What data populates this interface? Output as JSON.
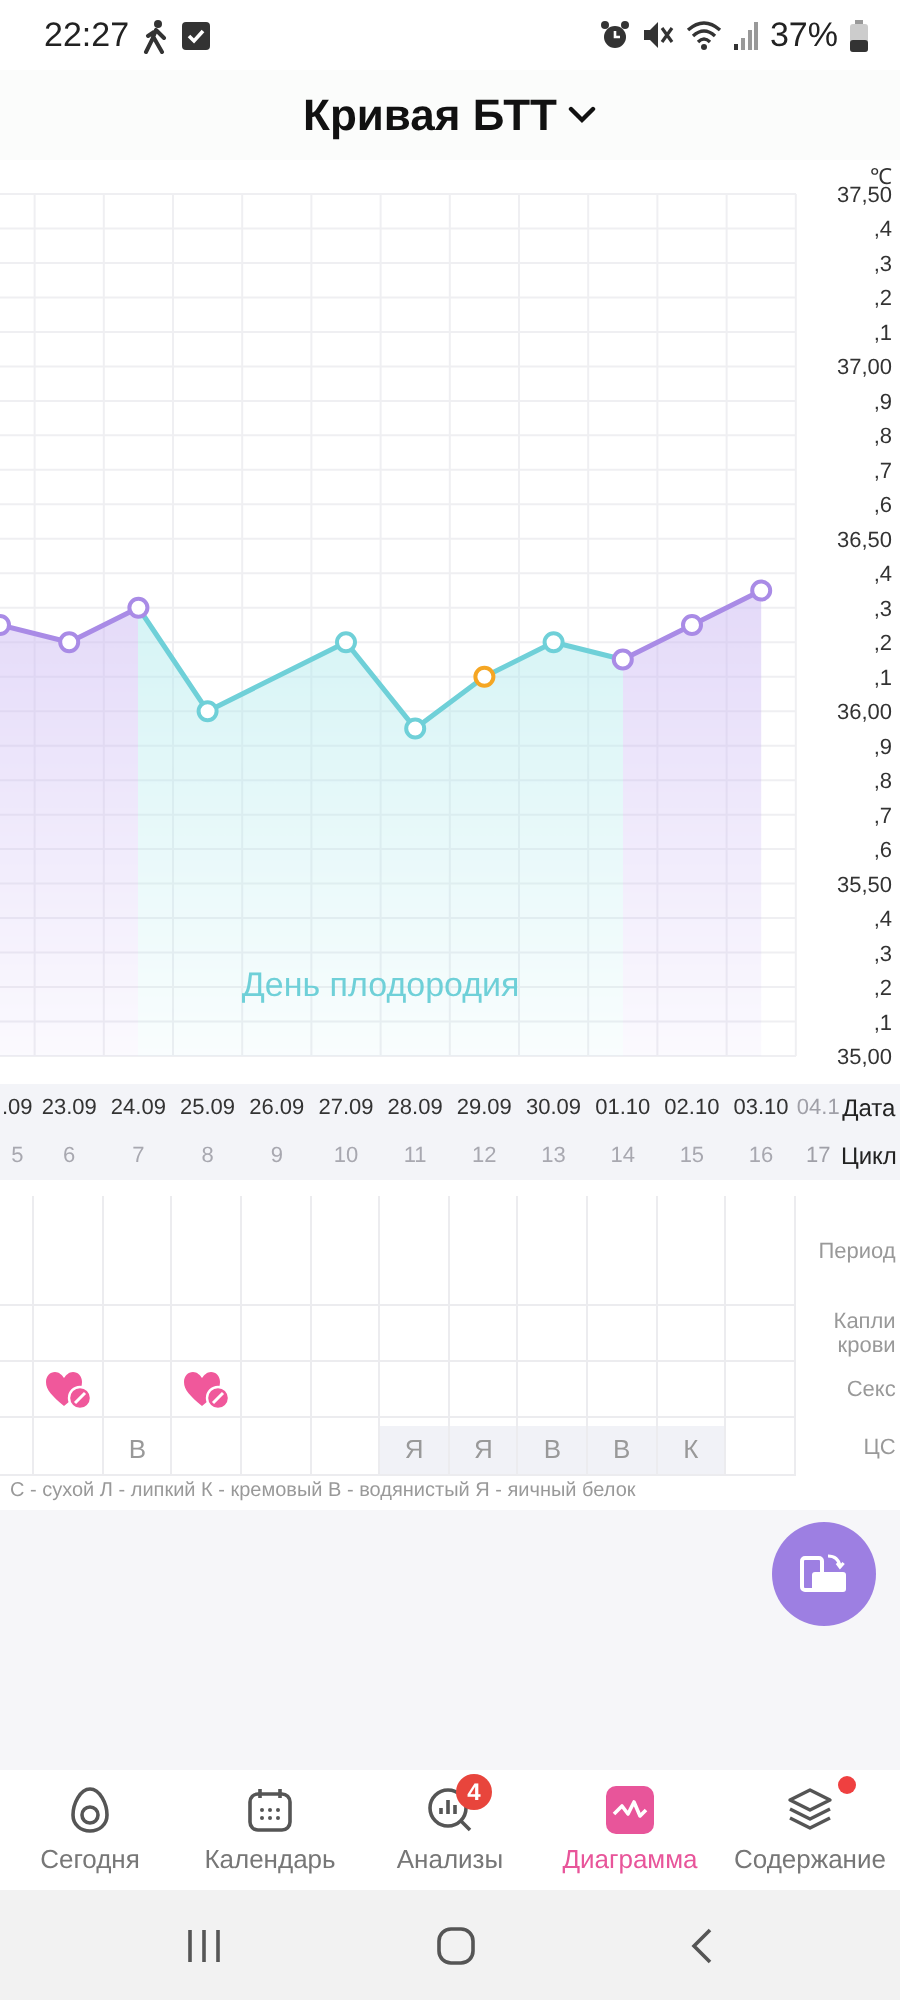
{
  "status_bar": {
    "time": "22:27",
    "battery": "37%"
  },
  "header": {
    "title": "Кривая БТТ"
  },
  "chart": {
    "unit": "℃",
    "minor_tick_labels": [
      ",4",
      ",3",
      ",2",
      ",1",
      ",9",
      ",8",
      ",7",
      ",6",
      ",4",
      ",3",
      ",2",
      ",1",
      ",9",
      ",8",
      ",7",
      ",6",
      ",4",
      ",3",
      ",2",
      ",1"
    ],
    "fertile_label": "День плодородия",
    "chart_data": {
      "type": "line",
      "categories": [
        ".09",
        "23.09",
        "24.09",
        "25.09",
        "26.09",
        "27.09",
        "28.09",
        "29.09",
        "30.09",
        "01.10",
        "02.10",
        "03.10",
        "04.1"
      ],
      "series": [
        {
          "color": "#a98be6",
          "marker": true,
          "values": [
            36.25,
            36.2,
            36.3,
            null,
            null,
            null,
            null,
            null,
            null,
            36.15,
            36.25,
            36.35,
            null
          ]
        },
        {
          "color": "#6fd0d8",
          "marker": true,
          "values": [
            null,
            null,
            36.3,
            36.0,
            null,
            36.2,
            35.95,
            36.1,
            36.2,
            36.15,
            null,
            null,
            null
          ]
        },
        {
          "color": "#f5a623",
          "marker": true,
          "values": [
            null,
            null,
            null,
            null,
            null,
            null,
            null,
            36.1,
            null,
            null,
            null,
            null,
            null
          ]
        }
      ],
      "ylim": [
        35,
        37.5
      ],
      "yticks": [
        {
          "value": 37.5,
          "label": "37,50"
        },
        {
          "value": 37.0,
          "label": "37,00"
        },
        {
          "value": 36.5,
          "label": "36,50"
        },
        {
          "value": 36.0,
          "label": "36,00"
        },
        {
          "value": 35.5,
          "label": "35,50"
        },
        {
          "value": 35.0,
          "label": "35,00"
        }
      ],
      "grid": true
    }
  },
  "date_strip": {
    "date_label": "Дата",
    "cycle_label": "Цикл",
    "days": [
      {
        "cycle": "5",
        "future": false
      },
      {
        "cycle": "6",
        "future": false
      },
      {
        "cycle": "7",
        "future": false
      },
      {
        "cycle": "8",
        "future": false
      },
      {
        "cycle": "9",
        "future": false
      },
      {
        "cycle": "10",
        "future": false
      },
      {
        "cycle": "11",
        "future": false
      },
      {
        "cycle": "12",
        "future": false
      },
      {
        "cycle": "13",
        "future": false
      },
      {
        "cycle": "14",
        "future": false
      },
      {
        "cycle": "15",
        "future": false
      },
      {
        "cycle": "16",
        "future": false
      },
      {
        "cycle": "17",
        "future": true
      }
    ]
  },
  "symptoms": {
    "rows": [
      {
        "label": "Период",
        "kind": "blank"
      },
      {
        "label": "Капли крови",
        "kind": "blank"
      },
      {
        "label": "Секс",
        "kind": "icon",
        "cells": [
          {
            "marked": false
          },
          {
            "marked": true
          },
          {
            "marked": false
          },
          {
            "marked": true
          },
          {
            "marked": false
          },
          {
            "marked": false
          },
          {
            "marked": false
          },
          {
            "marked": false
          },
          {
            "marked": false
          },
          {
            "marked": false
          },
          {
            "marked": false
          },
          {
            "marked": false
          }
        ]
      },
      {
        "label": "ЦС",
        "kind": "text",
        "cells": [
          {
            "shaded": false
          },
          {
            "shaded": false
          },
          {
            "text": "В",
            "shaded": false
          },
          {
            "shaded": false
          },
          {
            "shaded": false
          },
          {
            "shaded": false
          },
          {
            "text": "Я",
            "shaded": true
          },
          {
            "text": "Я",
            "shaded": true
          },
          {
            "text": "В",
            "shaded": true
          },
          {
            "text": "В",
            "shaded": true
          },
          {
            "text": "К",
            "shaded": true
          },
          {
            "shaded": false
          }
        ]
      }
    ],
    "legend": "С - сухой Л - липкий К - кремовый В - водянистый Я - яичный белок"
  },
  "nav": {
    "items": [
      {
        "label": "Сегодня",
        "selected": false,
        "dot": false
      },
      {
        "label": "Календарь",
        "selected": false,
        "dot": false
      },
      {
        "label": "Анализы",
        "selected": false,
        "badge": "4",
        "dot": false
      },
      {
        "label": "Диаграмма",
        "selected": true,
        "dot": false
      },
      {
        "label": "Содержание",
        "selected": false,
        "dot": true
      }
    ]
  }
}
